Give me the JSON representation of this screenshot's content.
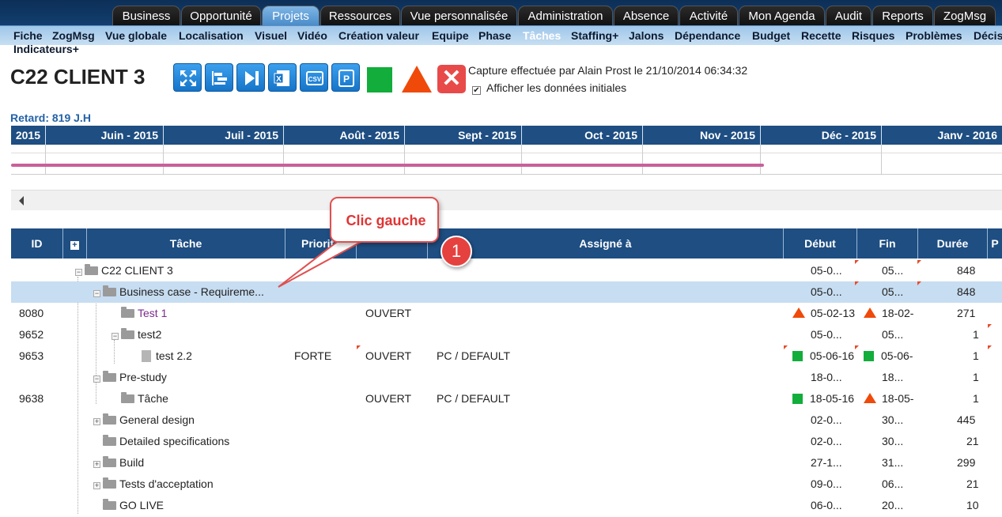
{
  "topnav": {
    "tabs": [
      "Business",
      "Opportunité",
      "Projets",
      "Ressources",
      "Vue personnalisée",
      "Administration",
      "Absence",
      "Activité",
      "Mon Agenda",
      "Audit",
      "Reports",
      "ZogMsg"
    ],
    "active": "Projets"
  },
  "subnav": {
    "items": [
      "Fiche",
      "ZogMsg",
      "Vue globale",
      "Localisation",
      "Visuel",
      "Vidéo",
      "Création valeur",
      "Equipe",
      "Phase",
      "Tâches",
      "Staffing+",
      "Jalons",
      "Dépendance",
      "Budget",
      "Recette",
      "Risques",
      "Problèmes",
      "Décis"
    ],
    "active": "Tâches",
    "second_line": "Indicateurs+"
  },
  "project": {
    "title": "C22 CLIENT 3",
    "capture_text": "Capture effectuée par Alain Prost le 21/10/2014 06:34:32",
    "checkbox_label": "Afficher les données initiales",
    "checkbox_checked": true,
    "retard": "Retard: 819 J.H"
  },
  "toolbar": {
    "icons": [
      "fullscreen-icon",
      "gantt-icon",
      "skip-end-icon",
      "excel-icon",
      "csv-icon",
      "p-icon"
    ],
    "csv_label": "CSV",
    "p_label": "P",
    "excel_label": "X"
  },
  "gantt": {
    "months": [
      "2015",
      "Juin - 2015",
      "Juil - 2015",
      "Août - 2015",
      "Sept - 2015",
      "Oct - 2015",
      "Nov - 2015",
      "Déc - 2015",
      "Janv - 2016"
    ],
    "bar_color": "#c9609a"
  },
  "table": {
    "headers": {
      "id": "ID",
      "tache": "Tâche",
      "priorite": "Priorité",
      "etat": "",
      "assigne": "Assigné à",
      "debut": "Début",
      "fin": "Fin",
      "duree": "Durée",
      "p": "P"
    },
    "rows": [
      {
        "id": "",
        "name": "C22 CLIENT 3",
        "level": 0,
        "priorite": "",
        "etat": "",
        "assigne": "",
        "debut": "05-0...",
        "fin": "05...",
        "duree": "848"
      },
      {
        "id": "",
        "name": "Business case - Requireme...",
        "level": 1,
        "priorite": "",
        "etat": "",
        "assigne": "",
        "debut": "05-0...",
        "fin": "05...",
        "duree": "848"
      },
      {
        "id": "8080",
        "name": "Test 1",
        "level": 2,
        "priorite": "",
        "etat": "OUVERT",
        "assigne": "",
        "debut": "05-02-13",
        "fin": "18-02-",
        "duree": "271"
      },
      {
        "id": "9652",
        "name": "test2",
        "level": 2,
        "priorite": "",
        "etat": "",
        "assigne": "",
        "debut": "05-0...",
        "fin": "05...",
        "duree": "1"
      },
      {
        "id": "9653",
        "name": "test 2.2",
        "level": 3,
        "priorite": "FORTE",
        "etat": "OUVERT",
        "assigne": "PC / DEFAULT",
        "debut": "05-06-16",
        "fin": "05-06-",
        "duree": "1"
      },
      {
        "id": "",
        "name": "Pre-study",
        "level": 1,
        "priorite": "",
        "etat": "",
        "assigne": "",
        "debut": "18-0...",
        "fin": "18...",
        "duree": "1"
      },
      {
        "id": "9638",
        "name": "Tâche",
        "level": 2,
        "priorite": "",
        "etat": "OUVERT",
        "assigne": "PC / DEFAULT",
        "debut": "18-05-16",
        "fin": "18-05-",
        "duree": "1"
      },
      {
        "id": "",
        "name": "General design",
        "level": 1,
        "priorite": "",
        "etat": "",
        "assigne": "",
        "debut": "02-0...",
        "fin": "30...",
        "duree": "445"
      },
      {
        "id": "",
        "name": "Detailed specifications",
        "level": 1,
        "priorite": "",
        "etat": "",
        "assigne": "",
        "debut": "02-0...",
        "fin": "30...",
        "duree": "21"
      },
      {
        "id": "",
        "name": "Build",
        "level": 1,
        "priorite": "",
        "etat": "",
        "assigne": "",
        "debut": "27-1...",
        "fin": "31...",
        "duree": "299"
      },
      {
        "id": "",
        "name": "Tests d'acceptation",
        "level": 1,
        "priorite": "",
        "etat": "",
        "assigne": "",
        "debut": "09-0...",
        "fin": "06...",
        "duree": "21"
      },
      {
        "id": "",
        "name": "GO LIVE",
        "level": 1,
        "priorite": "",
        "etat": "",
        "assigne": "",
        "debut": "06-0...",
        "fin": "20...",
        "duree": "10"
      }
    ]
  },
  "annotation": {
    "callout": "Clic gauche",
    "badge": "1"
  },
  "colors": {
    "header_blue": "#1e4e82",
    "selected_row": "#c7ddf1",
    "status_green": "#12ad3b",
    "status_red": "#ef4a0a",
    "callout_red": "#e03535"
  }
}
